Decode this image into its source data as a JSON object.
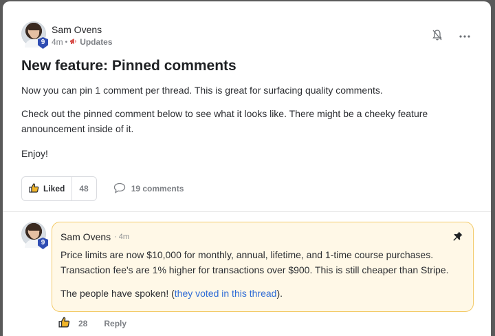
{
  "post": {
    "author": {
      "name": "Sam Ovens",
      "level": "9",
      "time": "4m",
      "separator": "•",
      "category": "Updates"
    },
    "title": "New feature: Pinned comments",
    "paragraphs": [
      "Now you can pin 1 comment per thread. This is great for surfacing quality comments.",
      "Check out the pinned comment below to see what it looks like. There might be a cheeky feature announcement inside of it.",
      "Enjoy!"
    ],
    "actions": {
      "like_label": "Liked",
      "like_count": "48",
      "comments_label": "19 comments"
    },
    "top_icons": [
      "bell-off-icon",
      "more-icon"
    ]
  },
  "comment": {
    "author": {
      "name": "Sam Ovens",
      "level": "9",
      "time": "· 4m"
    },
    "paragraph1": "Price limits are now $10,000 for monthly, annual, lifetime, and 1-time course purchases. Transaction fee's are 1% higher for transactions over $900. This is still cheaper than Stripe.",
    "paragraph2_prefix": "The people have spoken! (",
    "paragraph2_link": "they voted in this thread",
    "paragraph2_suffix": ").",
    "like_count": "28",
    "reply_label": "Reply",
    "pinned_icon": "pin-icon"
  },
  "colors": {
    "accent_link": "#2e6bd6",
    "pinned_bg": "#fff8e7",
    "pinned_border": "#f3ca68",
    "badge": "#2f4db3"
  }
}
